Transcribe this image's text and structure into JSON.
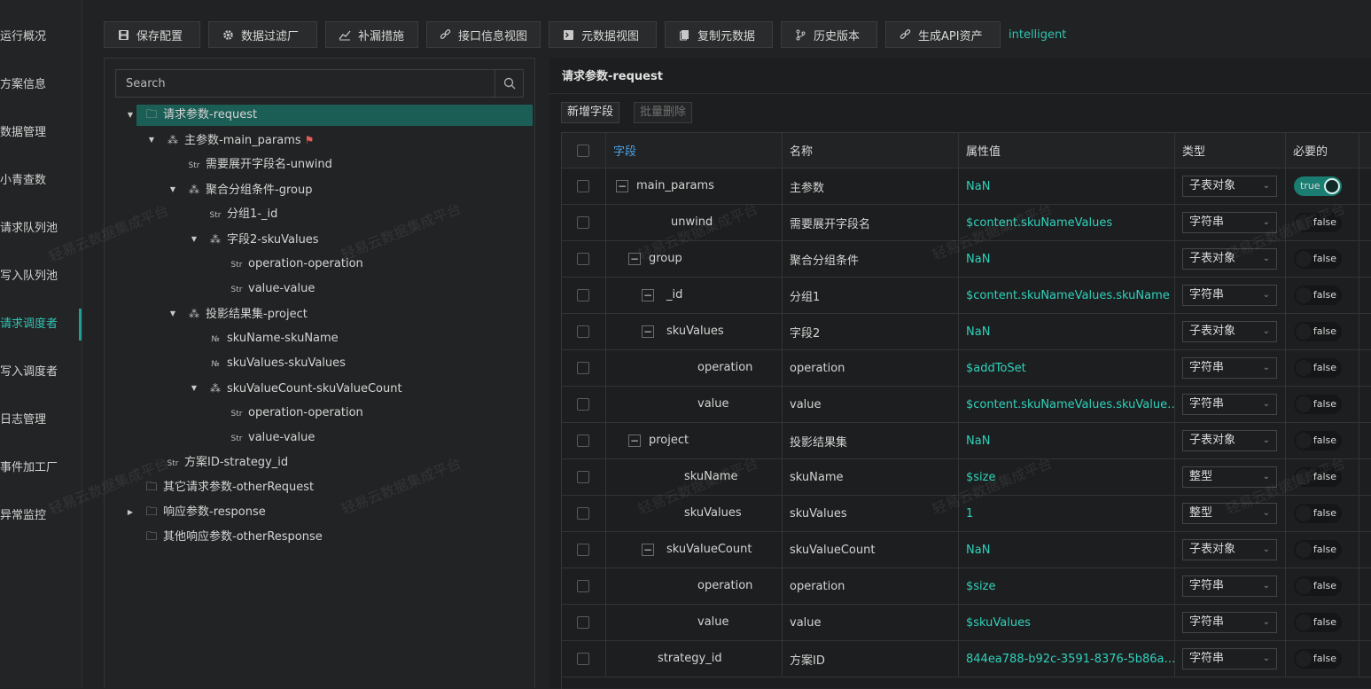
{
  "nav": {
    "items": [
      "运行概况",
      "方案信息",
      "数据管理",
      "小青查数",
      "请求队列池",
      "写入队列池",
      "请求调度者",
      "写入调度者",
      "日志管理",
      "事件加工厂",
      "异常监控"
    ],
    "active_index": 6
  },
  "toolbar": {
    "buttons": [
      {
        "label": "保存配置",
        "icon": "save-icon"
      },
      {
        "label": "数据过滤厂",
        "icon": "gear-icon"
      },
      {
        "label": "补漏措施",
        "icon": "trend-icon"
      },
      {
        "label": "接口信息视图",
        "icon": "link-icon"
      },
      {
        "label": "元数据视图",
        "icon": "terminal-icon"
      },
      {
        "label": "复制元数据",
        "icon": "copy-icon"
      },
      {
        "label": "历史版本",
        "icon": "branch-icon"
      },
      {
        "label": "生成API资产",
        "icon": "link-icon"
      }
    ],
    "link": "intelligent"
  },
  "tree": {
    "search_placeholder": "Search",
    "nodes": [
      {
        "label": "请求参数-request",
        "type": "folder",
        "arrow": "down",
        "selected": true
      },
      {
        "label": "主参数-main_params",
        "type": "object",
        "arrow": "down",
        "flag": true
      },
      {
        "label": "需要展开字段名-unwind",
        "type": "str",
        "arrow": ""
      },
      {
        "label": "聚合分组条件-group",
        "type": "object",
        "arrow": "down"
      },
      {
        "label": "分组1-_id",
        "type": "str",
        "arrow": ""
      },
      {
        "label": "字段2-skuValues",
        "type": "object",
        "arrow": "down"
      },
      {
        "label": "operation-operation",
        "type": "str",
        "arrow": ""
      },
      {
        "label": "value-value",
        "type": "str",
        "arrow": ""
      },
      {
        "label": "投影结果集-project",
        "type": "object",
        "arrow": "down"
      },
      {
        "label": "skuName-skuName",
        "type": "num",
        "arrow": ""
      },
      {
        "label": "skuValues-skuValues",
        "type": "num",
        "arrow": ""
      },
      {
        "label": "skuValueCount-skuValueCount",
        "type": "object",
        "arrow": "down"
      },
      {
        "label": "operation-operation",
        "type": "str",
        "arrow": ""
      },
      {
        "label": "value-value",
        "type": "str",
        "arrow": ""
      },
      {
        "label": "方案ID-strategy_id",
        "type": "str",
        "arrow": ""
      },
      {
        "label": "其它请求参数-otherRequest",
        "type": "folder",
        "arrow": ""
      },
      {
        "label": "响应参数-response",
        "type": "folder",
        "arrow": "right"
      },
      {
        "label": "其他响应参数-otherResponse",
        "type": "folder",
        "arrow": ""
      }
    ],
    "type_glyphs": {
      "str": "Str",
      "num": "№",
      "object": "⁂",
      "folder": "🗀"
    }
  },
  "panel": {
    "title": "请求参数-request",
    "add_label": "新增字段",
    "batch_delete_label": "批量删除",
    "columns": [
      "字段",
      "名称",
      "属性值",
      "类型",
      "必要的"
    ],
    "rows": [
      {
        "field": "main_params",
        "name": "主参数",
        "value": "NaN",
        "type": "子表对象",
        "required": "true",
        "toggle": true
      },
      {
        "field": "unwind",
        "name": "需要展开字段名",
        "value": "$content.skuNameValues",
        "type": "字符串",
        "required": "false",
        "toggle": false
      },
      {
        "field": "group",
        "name": "聚合分组条件",
        "value": "NaN",
        "type": "子表对象",
        "required": "false",
        "toggle": true
      },
      {
        "field": "_id",
        "name": "分组1",
        "value": "$content.skuNameValues.skuName",
        "type": "字符串",
        "required": "false",
        "toggle": true
      },
      {
        "field": "skuValues",
        "name": "字段2",
        "value": "NaN",
        "type": "子表对象",
        "required": "false",
        "toggle": true
      },
      {
        "field": "operation",
        "name": "operation",
        "value": "$addToSet",
        "type": "字符串",
        "required": "false",
        "toggle": false
      },
      {
        "field": "value",
        "name": "value",
        "value": "$content.skuNameValues.skuValue…",
        "type": "字符串",
        "required": "false",
        "toggle": false
      },
      {
        "field": "project",
        "name": "投影结果集",
        "value": "NaN",
        "type": "子表对象",
        "required": "false",
        "toggle": true
      },
      {
        "field": "skuName",
        "name": "skuName",
        "value": "$size",
        "type": "整型",
        "required": "false",
        "toggle": false
      },
      {
        "field": "skuValues",
        "name": "skuValues",
        "value": "1",
        "type": "整型",
        "required": "false",
        "toggle": false
      },
      {
        "field": "skuValueCount",
        "name": "skuValueCount",
        "value": "NaN",
        "type": "子表对象",
        "required": "false",
        "toggle": true
      },
      {
        "field": "operation",
        "name": "operation",
        "value": "$size",
        "type": "字符串",
        "required": "false",
        "toggle": false
      },
      {
        "field": "value",
        "name": "value",
        "value": "$skuValues",
        "type": "字符串",
        "required": "false",
        "toggle": false
      },
      {
        "field": "strategy_id",
        "name": "方案ID",
        "value": "844ea788-b92c-3591-8376-5b86a…",
        "type": "字符串",
        "required": "false",
        "toggle": false
      }
    ]
  },
  "watermark": "轻易云数据集成平台",
  "colors": {
    "accent": "#2fc4b2",
    "selected": "#1b5e56",
    "value_text": "#2fd2bd",
    "switch_on": "#1b7d72"
  }
}
